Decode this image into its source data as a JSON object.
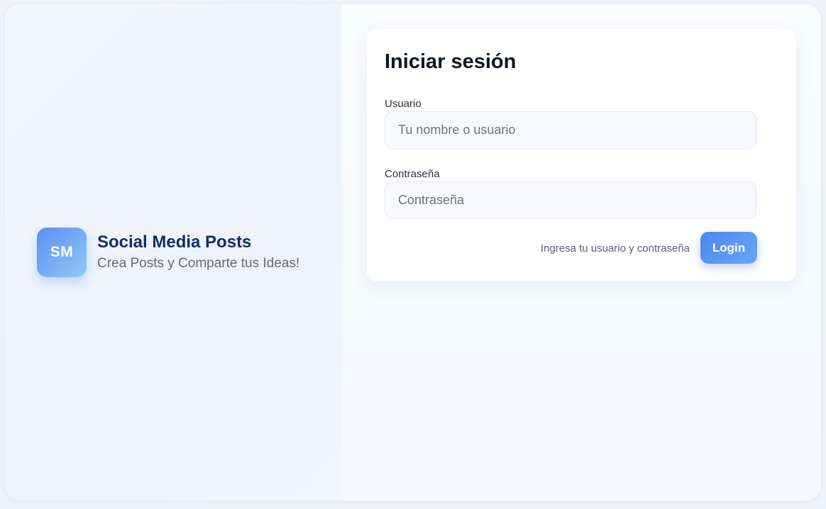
{
  "brand": {
    "logo_text": "SM",
    "title": "Social Media Posts",
    "subtitle": "Crea Posts y Comparte tus Ideas!"
  },
  "login_form": {
    "title": "Iniciar sesión",
    "username": {
      "label": "Usuario",
      "placeholder": "Tu nombre o usuario",
      "value": ""
    },
    "password": {
      "label": "Contraseña",
      "placeholder": "Contraseña",
      "value": ""
    },
    "hint": "Ingresa tu usuario y contraseña",
    "submit_label": "Login"
  },
  "colors": {
    "accent": "#4d86ef",
    "brand_title": "#0f2e63",
    "logo_gradient_start": "#5b8ef0",
    "logo_gradient_end": "#8fc9fb"
  }
}
